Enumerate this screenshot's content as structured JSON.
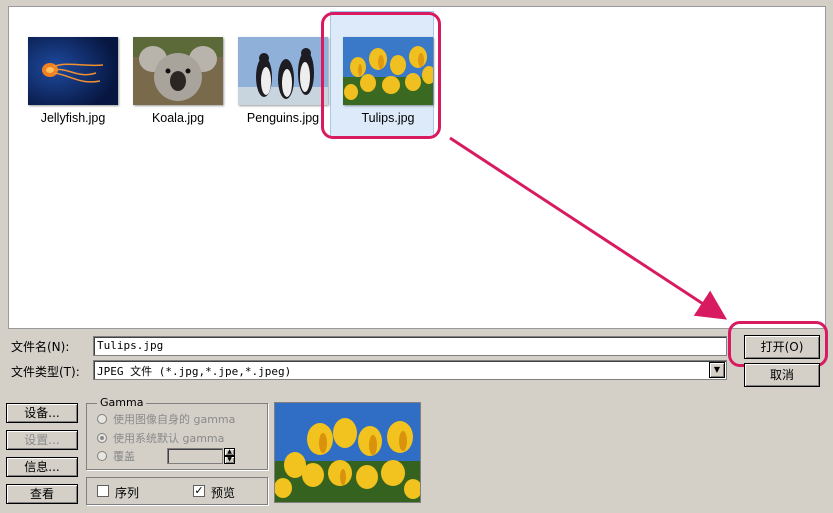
{
  "files": [
    {
      "name": "Jellyfish.jpg",
      "thumb": "jellyfish"
    },
    {
      "name": "Koala.jpg",
      "thumb": "koala"
    },
    {
      "name": "Penguins.jpg",
      "thumb": "penguins"
    },
    {
      "name": "Tulips.jpg",
      "thumb": "tulips",
      "selected": true
    }
  ],
  "filename": {
    "label": "文件名(N):",
    "value": "Tulips.jpg"
  },
  "filetype": {
    "label": "文件类型(T):",
    "value": "JPEG 文件 (*.jpg,*.jpe,*.jpeg)"
  },
  "buttons": {
    "open": "打开(O)",
    "cancel": "取消",
    "settings": "设备...",
    "settings2": "设置...",
    "info": "信息...",
    "view": "查看"
  },
  "gamma": {
    "title": "Gamma",
    "option1": "使用图像自身的 gamma",
    "option2": "使用系统默认 gamma",
    "option3": "覆盖"
  },
  "options": {
    "sequence": "序列",
    "preview": "预览",
    "preview_checked": true,
    "sequence_checked": false
  },
  "colors": {
    "accent": "#d81b60",
    "selection": "#dceaf9",
    "dialog_bg": "#d4d0c8"
  },
  "icons": {
    "check": "✓",
    "dropdown": "▼",
    "spin_up": "▲",
    "spin_down": "▼"
  }
}
